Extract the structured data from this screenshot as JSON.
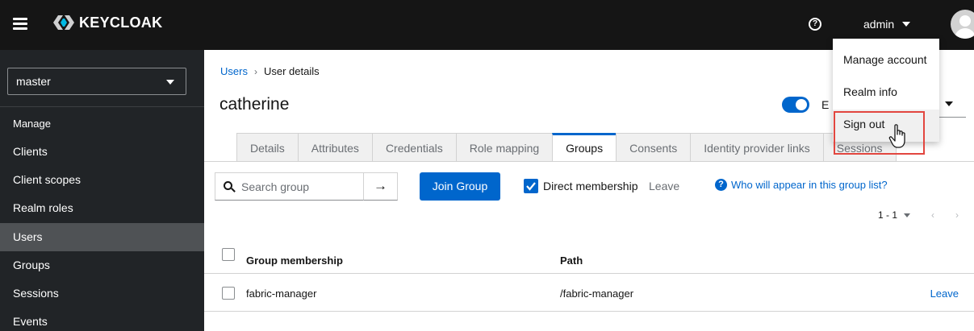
{
  "masthead": {
    "brand": "KEYCLOAK",
    "help_icon_glyph": "?",
    "username": "admin",
    "icons": [
      "hamburger-icon",
      "keycloak-logo-icon",
      "help-icon",
      "chevron-down-icon",
      "avatar-icon"
    ]
  },
  "sidebar": {
    "realm": "master",
    "section": "Manage",
    "items": [
      {
        "label": "Clients",
        "active": false
      },
      {
        "label": "Client scopes",
        "active": false
      },
      {
        "label": "Realm roles",
        "active": false
      },
      {
        "label": "Users",
        "active": true
      },
      {
        "label": "Groups",
        "active": false
      },
      {
        "label": "Sessions",
        "active": false
      },
      {
        "label": "Events",
        "active": false
      }
    ]
  },
  "breadcrumb": {
    "parent": "Users",
    "separator": "›",
    "current": "User details"
  },
  "page": {
    "title": "catherine",
    "enabled_label_partial": "E",
    "enabled": true
  },
  "tabs": [
    {
      "label": "Details",
      "active": false
    },
    {
      "label": "Attributes",
      "active": false
    },
    {
      "label": "Credentials",
      "active": false
    },
    {
      "label": "Role mapping",
      "active": false
    },
    {
      "label": "Groups",
      "active": true
    },
    {
      "label": "Consents",
      "active": false
    },
    {
      "label": "Identity provider links",
      "active": false
    },
    {
      "label": "Sessions",
      "active": false
    }
  ],
  "toolbar": {
    "search_placeholder": "Search group",
    "search_go": "→",
    "join_button": "Join Group",
    "direct_membership_label": "Direct membership",
    "direct_membership_checked": true,
    "leave_label": "Leave",
    "info_glyph": "?",
    "info_link": "Who will appear in this group list?"
  },
  "pagination": {
    "range": "1 - 1",
    "prev": "‹",
    "next": "›"
  },
  "table": {
    "columns": [
      "Group membership",
      "Path"
    ],
    "rows": [
      {
        "name": "fabric-manager",
        "path": "/fabric-manager",
        "action": "Leave"
      }
    ]
  },
  "user_dropdown": {
    "items": [
      "Manage account",
      "Realm info",
      "Sign out"
    ],
    "hovered": "Sign out"
  },
  "colors": {
    "masthead": "#151515",
    "sidebar": "#212427",
    "sidebar_active": "#4f5255",
    "primary": "#0066cc",
    "highlight": "#e2463f"
  }
}
